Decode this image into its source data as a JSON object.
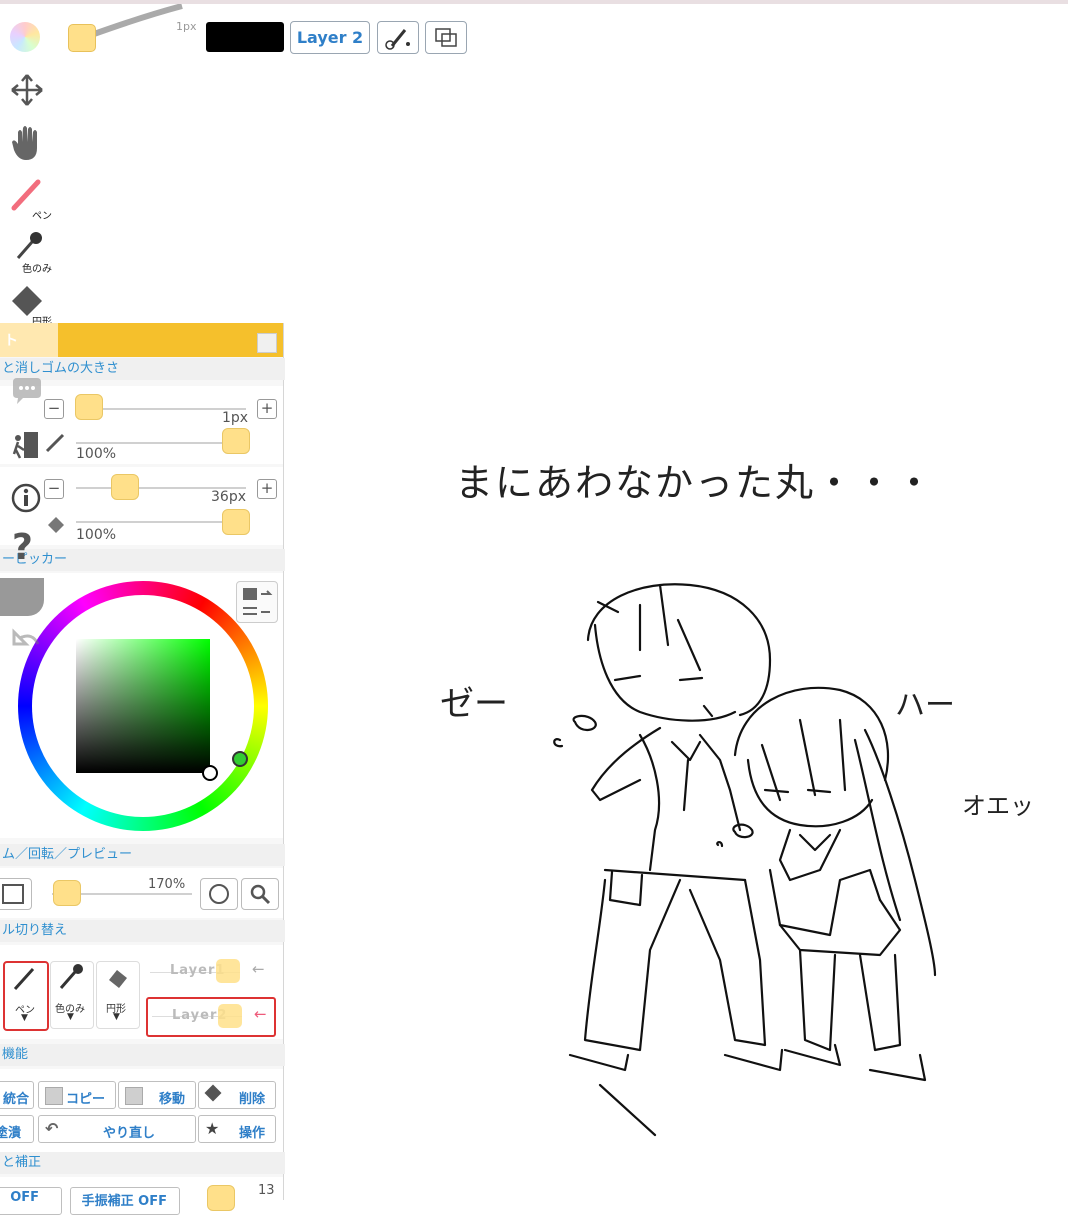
{
  "toolbar": {
    "brush_size_hint": "1px",
    "layer_button": "Layer 2",
    "current_color": "#000000"
  },
  "left_tools": {
    "move": "move-icon",
    "hand": "hand-icon",
    "pen_label": "ペン",
    "eyedropper_label": "色のみ",
    "shape_label": "円形"
  },
  "side_icons": [
    "chat-bubble-icon",
    "exit-icon",
    "info-icon",
    "help-icon",
    "undo-icon"
  ],
  "panel": {
    "header_fragment": "ト",
    "size_section": "と消しゴムの大きさ",
    "pen_size": "1px",
    "pen_opacity": "100%",
    "eraser_size": "36px",
    "eraser_opacity": "100%",
    "picker_section": "ーピッカー",
    "zoom_section": "ム／回転／プレビュー",
    "zoom_value": "170%",
    "tool_switch_section": "ル切り替え",
    "quick_tools": [
      {
        "label": "ペン"
      },
      {
        "label": "色のみ"
      },
      {
        "label": "円形"
      }
    ],
    "layers": [
      "Layer1",
      "Layer2"
    ],
    "functions_section": "機能",
    "func_buttons_row1": [
      "統合",
      "コピー",
      "移動",
      "削除"
    ],
    "func_buttons_row2": [
      "塗潰し",
      "やり直し",
      "操作"
    ],
    "correction_section": "と補正",
    "correction_buttons": [
      "OFF",
      "手振補正 OFF"
    ],
    "correction_value": "13"
  },
  "colors": {
    "accent": "#f5c02c",
    "knob": "#ffe08a",
    "link_blue": "#2f8fcf"
  },
  "drawing": {
    "caption": "まにあわなかった丸・・・",
    "sfx_left": "ゼー",
    "sfx_right": "ハー",
    "sfx_small": "オエッ"
  }
}
